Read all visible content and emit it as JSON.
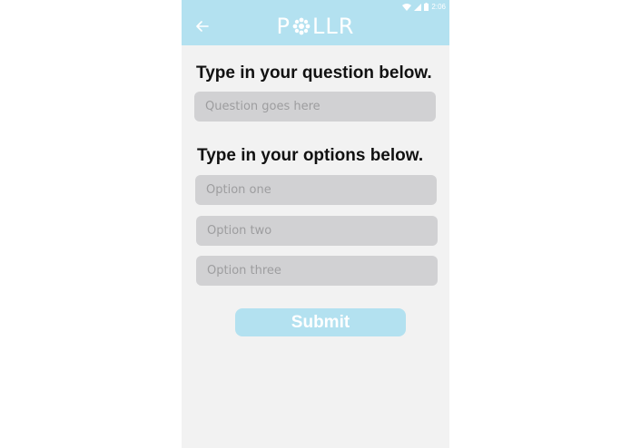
{
  "status_bar": {
    "time": "2:06",
    "icons": [
      "wifi-icon",
      "signal-icon",
      "battery-icon"
    ]
  },
  "app_bar": {
    "back_icon": "arrow-left-icon",
    "logo_text_start": "P",
    "logo_text_end": "LLR",
    "logo_icon": "flower-icon"
  },
  "form": {
    "question_heading": "Type in your question below.",
    "question_placeholder": "Question goes here",
    "options_heading": "Type in your options below.",
    "options": [
      {
        "placeholder": "Option one"
      },
      {
        "placeholder": "Option two"
      },
      {
        "placeholder": "Option three"
      }
    ],
    "submit_label": "Submit"
  },
  "colors": {
    "accent": "#b3e1f0",
    "background": "#f2f2f2",
    "field": "#d1d1d3",
    "heading": "#111111",
    "placeholder": "#9d9d9f"
  }
}
